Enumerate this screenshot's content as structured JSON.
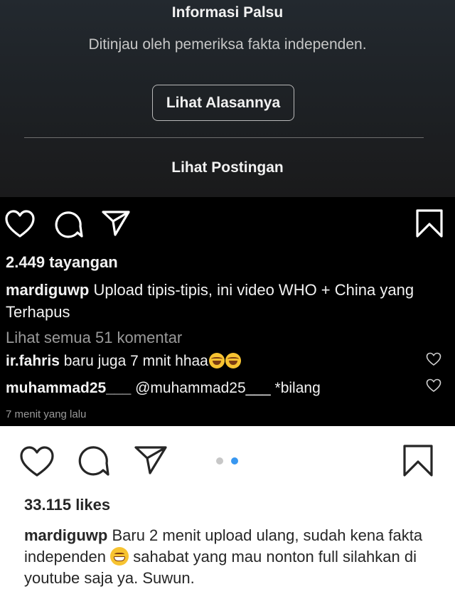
{
  "overlay": {
    "title": "Informasi Palsu",
    "subtitle": "Ditinjau oleh pemeriksa fakta independen.",
    "reason_button": "Lihat Alasannya",
    "view_post_link": "Lihat Postingan"
  },
  "dark_post": {
    "views": "2.449 tayangan",
    "caption_user": "mardiguwp",
    "caption_text": "Upload tipis-tipis, ini video WHO + China yang Terhapus",
    "view_all_comments": "Lihat semua 51 komentar",
    "comments": [
      {
        "user": "ir.fahris",
        "text": "baru juga 7 mnit hhaa"
      },
      {
        "user": "muhammad25___",
        "text": "@muhammad25___ *bilang"
      }
    ],
    "time": "7 menit yang lalu"
  },
  "light_post": {
    "likes": "33.115 likes",
    "caption_user": "mardiguwp",
    "caption_text_1": "Baru 2 menit upload ulang, sudah kena fakta independen",
    "caption_text_2": "sahabat yang mau nonton full silahkan di youtube saja ya. Suwun.",
    "carousel_active_index": 1,
    "carousel_count": 2
  },
  "icons": [
    "heart-icon",
    "comment-icon",
    "share-icon",
    "bookmark-icon"
  ],
  "colors": {
    "dark_bg": "#000000",
    "overlay_bg": "#1e2226",
    "accent_dot": "#3897f0",
    "inactive_dot": "#c7c7c7"
  }
}
